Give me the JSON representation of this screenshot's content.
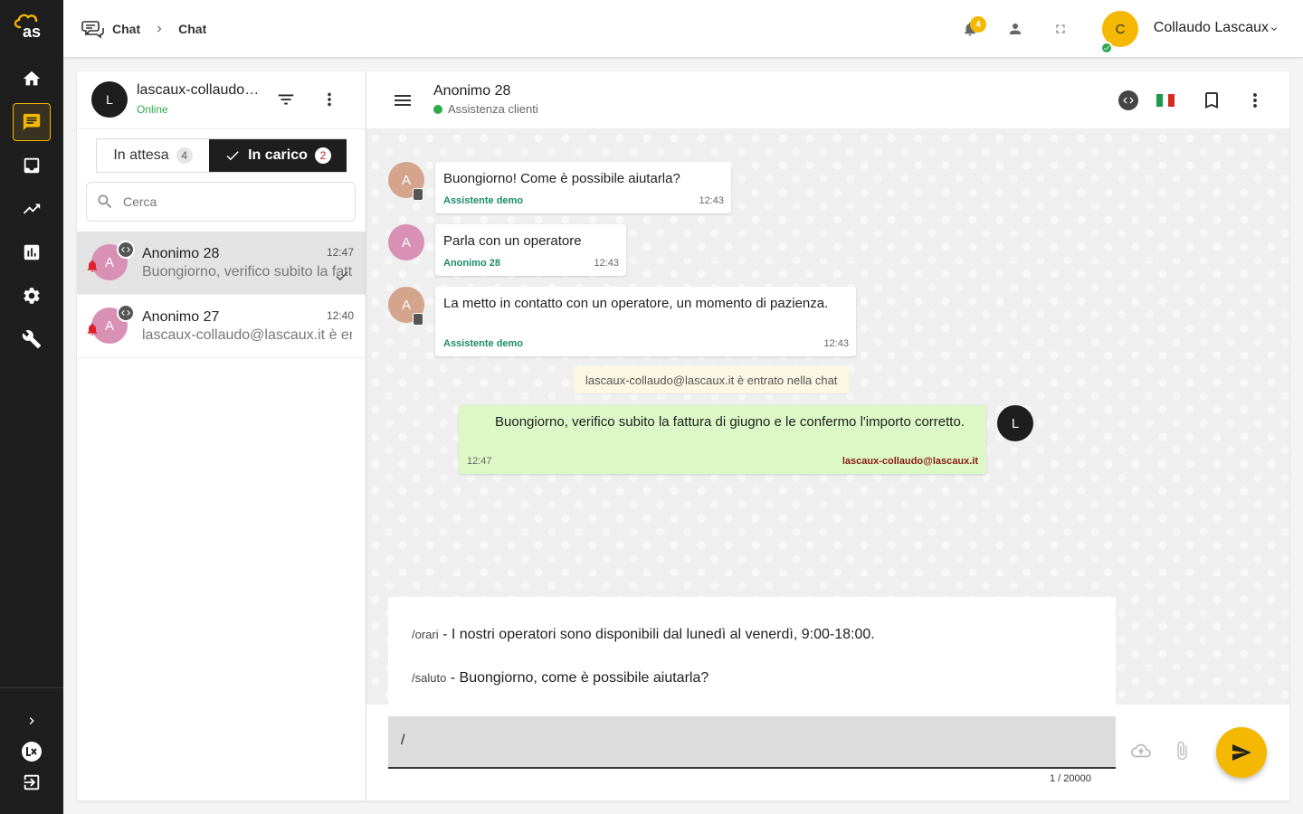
{
  "topbar": {
    "breadcrumb_root": "Chat",
    "breadcrumb_current": "Chat",
    "notification_count": "4",
    "user_initial": "C",
    "user_name": "Collaudo Lascaux"
  },
  "sidebar": {
    "logo_text": "as",
    "items": [
      "home-icon",
      "chat-icon",
      "inbox-icon",
      "trending-icon",
      "chart-icon",
      "gear-icon",
      "wrench-icon"
    ],
    "active_item": "chat-icon",
    "bottom_items": [
      "chevron-right-icon",
      "lx-logo-icon",
      "logout-icon"
    ]
  },
  "list_panel": {
    "agent_initial": "L",
    "agent_name": "lascaux-collaudo@lascaux.it",
    "agent_status": "Online",
    "tabs": [
      {
        "label": "In attesa",
        "count": "4"
      },
      {
        "label": "In carico",
        "count": "2"
      }
    ],
    "search_placeholder": "Cerca",
    "conversations": [
      {
        "initial": "A",
        "name": "Anonimo 28",
        "time": "12:47",
        "preview": "Buongiorno, verifico subito la fattura di giugno e le confermo l'importo corretto."
      },
      {
        "initial": "A",
        "name": "Anonimo 27",
        "time": "12:40",
        "preview": "lascaux-collaudo@lascaux.it è entrato nella chat"
      }
    ]
  },
  "chat": {
    "title": "Anonimo 28",
    "subtitle": "Assistenza clienti",
    "flag_colors": [
      "#1a9a4a",
      "#ffffff",
      "#d52b1e"
    ],
    "messages": [
      {
        "type": "bot",
        "initial": "A",
        "text": "Buongiorno! Come è possibile aiutarla?",
        "author": "Assistente demo",
        "time": "12:43"
      },
      {
        "type": "user",
        "initial": "A",
        "text": "Parla con un operatore",
        "author": "Anonimo 28",
        "time": "12:43"
      },
      {
        "type": "bot",
        "initial": "A",
        "text": "La metto in contatto con un operatore, un momento di pazienza.",
        "author": "Assistente demo",
        "time": "12:43"
      },
      {
        "type": "agent",
        "initial": "L",
        "text": "Buongiorno, verifico subito la fattura di giugno e le confermo l'importo corretto.",
        "author": "lascaux-collaudo@lascaux.it",
        "time": "12:47"
      }
    ],
    "system_message": "lascaux-collaudo@lascaux.it è entrato nella chat",
    "suggestions": [
      {
        "command": "/orari",
        "text": " - I nostri operatori sono disponibili dal lunedì al venerdì, 9:00-18:00."
      },
      {
        "command": "/saluto",
        "text": " - Buongiorno, come è possibile aiutarla?"
      }
    ],
    "composer_value": "/",
    "char_count": "1 / 20000"
  },
  "colors": {
    "accent": "#f5b800",
    "rail": "#1e1e1e",
    "online": "#2eaa4a",
    "agent_bubble": "#dcf8c6",
    "bot_author": "#1c8b6a",
    "agent_author": "#8b1a1a"
  }
}
